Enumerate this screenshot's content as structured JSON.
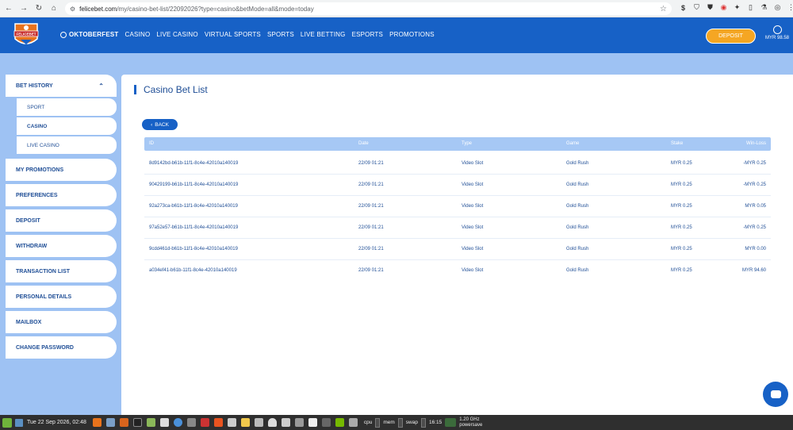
{
  "browser": {
    "url_host": "felicebet.com",
    "url_path": "/my/casino-bet-list/22092026?type=casino&betMode=all&mode=today"
  },
  "header": {
    "logo_text": "FELICEBET",
    "nav": [
      "OKTOBERFEST",
      "CASINO",
      "LIVE CASINO",
      "VIRTUAL SPORTS",
      "SPORTS",
      "LIVE BETTING",
      "ESPORTS",
      "PROMOTIONS"
    ],
    "deposit_label": "DEPOSIT",
    "balance": "MYR 98.58"
  },
  "sidebar": {
    "bet_history": "BET HISTORY",
    "sub": [
      "SPORT",
      "CASINO",
      "LIVE CASINO"
    ],
    "items": [
      "MY PROMOTIONS",
      "PREFERENCES",
      "DEPOSIT",
      "WITHDRAW",
      "TRANSACTION LIST",
      "PERSONAL DETAILS",
      "MAILBOX",
      "CHANGE PASSWORD"
    ]
  },
  "main": {
    "title": "Casino Bet List",
    "back_label": "BACK",
    "columns": [
      "ID",
      "Date",
      "Type",
      "Game",
      "Stake",
      "Win-Loss"
    ],
    "rows": [
      [
        "8d9142bd-b61b-11f1-8c4e-42010a140019",
        "22/09 01:21",
        "Video Slot",
        "Gold Rush",
        "MYR 0.25",
        "-MYR 0.25"
      ],
      [
        "90429199-b61b-11f1-8c4e-42010a140019",
        "22/09 01:21",
        "Video Slot",
        "Gold Rush",
        "MYR 0.25",
        "-MYR 0.25"
      ],
      [
        "92a273ca-b61b-11f1-8c4e-42010a140019",
        "22/09 01:21",
        "Video Slot",
        "Gold Rush",
        "MYR 0.25",
        "MYR 0.05"
      ],
      [
        "97a52e57-b61b-11f1-8c4e-42010a140019",
        "22/09 01:21",
        "Video Slot",
        "Gold Rush",
        "MYR 0.25",
        "-MYR 0.25"
      ],
      [
        "9cdd461d-b61b-11f1-8c4e-42010a140019",
        "22/09 01:21",
        "Video Slot",
        "Gold Rush",
        "MYR 0.25",
        "MYR 0.00"
      ],
      [
        "a034ef41-b61b-11f1-8c4e-42010a140019",
        "22/09 01:21",
        "Video Slot",
        "Gold Rush",
        "MYR 0.25",
        "MYR 94.60"
      ]
    ]
  },
  "taskbar": {
    "clock": "Tue 22 Sep 2026, 02:48",
    "monitors": [
      "cpu",
      "mem",
      "swap"
    ],
    "time": "16:15",
    "cpu_freq": "1.20 GHz",
    "cpu_mode": "powersave"
  }
}
